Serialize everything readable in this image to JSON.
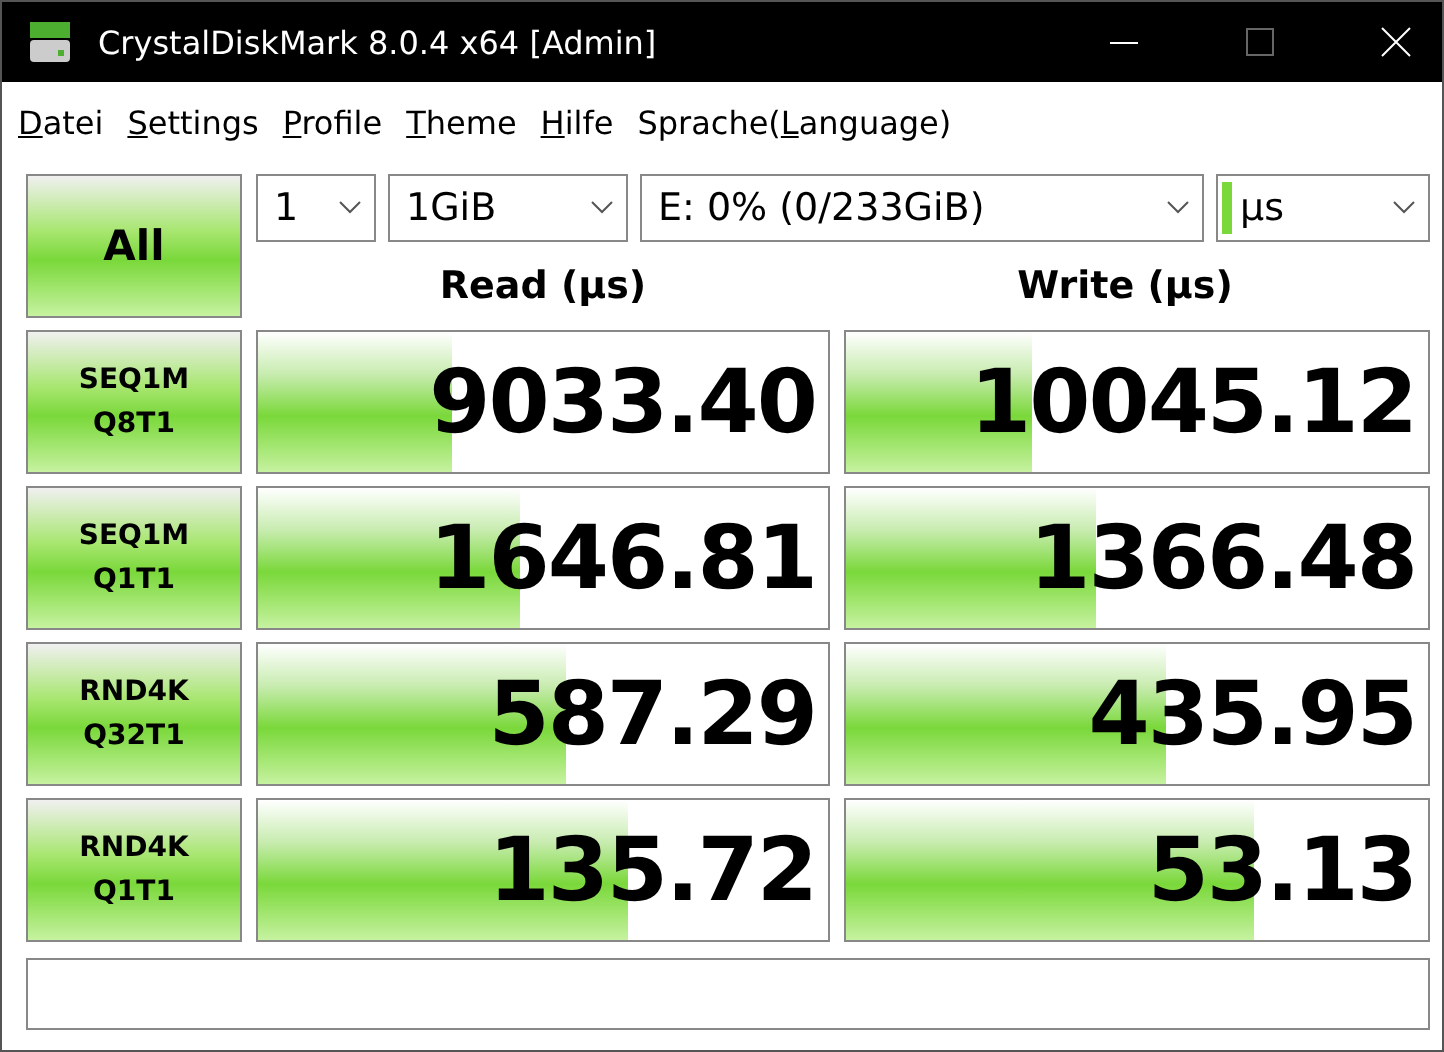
{
  "window": {
    "title": "CrystalDiskMark 8.0.4 x64 [Admin]"
  },
  "menu": [
    {
      "mnemonic": "D",
      "after": "atei"
    },
    {
      "mnemonic": "S",
      "after": "ettings"
    },
    {
      "mnemonic": "P",
      "after": "rofile"
    },
    {
      "mnemonic": "T",
      "after": "heme"
    },
    {
      "mnemonic": "H",
      "after": "ilfe"
    },
    {
      "before": "Sprache(",
      "mnemonic": "L",
      "after": "anguage)"
    }
  ],
  "all_button": "All",
  "selectors": {
    "count": "1",
    "size": "1GiB",
    "drive": "E: 0% (0/233GiB)",
    "unit": "µs"
  },
  "columns": [
    "Read (µs)",
    "Write (µs)"
  ],
  "tests": [
    {
      "line1": "SEQ1M",
      "line2": "Q8T1",
      "read": {
        "value": "9033.40",
        "level": 0.34
      },
      "write": {
        "value": "10045.12",
        "level": 0.32
      }
    },
    {
      "line1": "SEQ1M",
      "line2": "Q1T1",
      "read": {
        "value": "1646.81",
        "level": 0.46
      },
      "write": {
        "value": "1366.48",
        "level": 0.43
      }
    },
    {
      "line1": "RND4K",
      "line2": "Q32T1",
      "read": {
        "value": "587.29",
        "level": 0.54
      },
      "write": {
        "value": "435.95",
        "level": 0.55
      }
    },
    {
      "line1": "RND4K",
      "line2": "Q1T1",
      "read": {
        "value": "135.72",
        "level": 0.65
      },
      "write": {
        "value": "53.13",
        "level": 0.7
      }
    }
  ]
}
